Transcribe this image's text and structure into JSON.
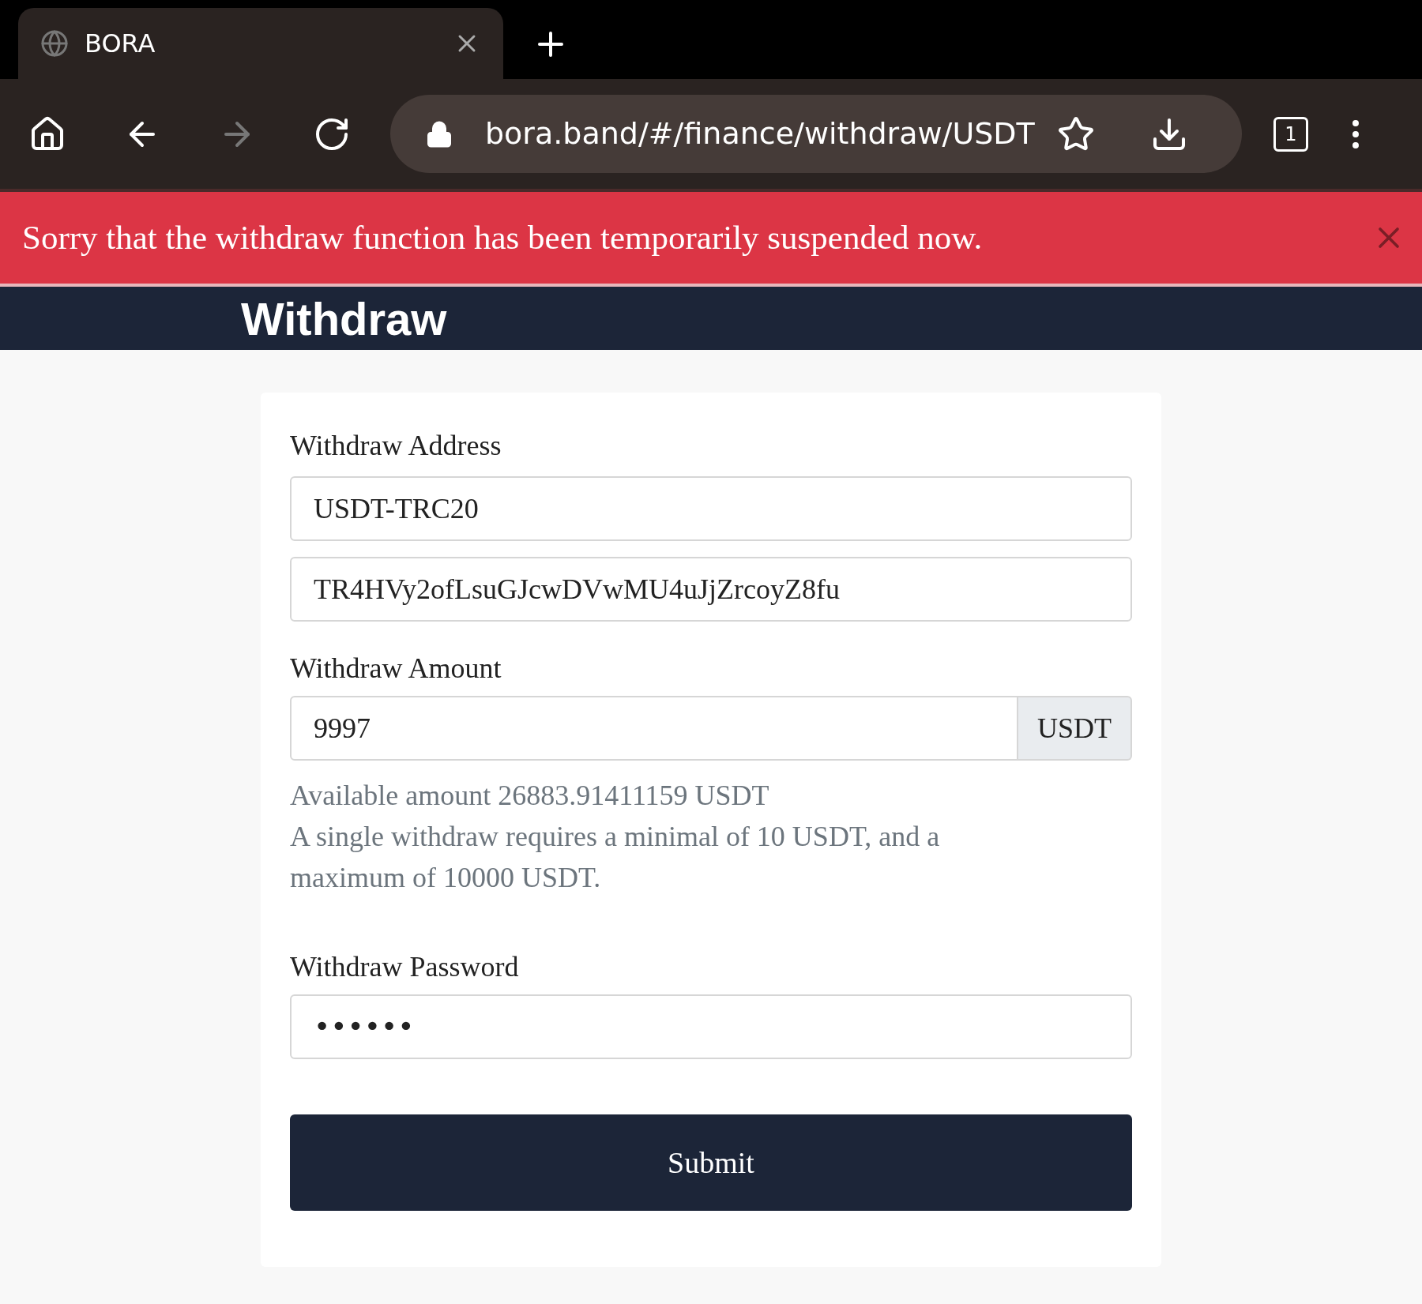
{
  "browser": {
    "tab": {
      "title": "BORA"
    },
    "url": "bora.band/#/finance/withdraw/USDT",
    "tab_count": "1"
  },
  "banner": {
    "message": "Sorry that the withdraw function has been temporarily suspended now."
  },
  "header": {
    "title": "Withdraw"
  },
  "form": {
    "address_label": "Withdraw Address",
    "network": "USDT-TRC20",
    "address": "TR4HVy2ofLsuGJcwDVwMU4uJjZrcoyZ8fu",
    "amount_label": "Withdraw Amount",
    "amount": "9997",
    "amount_unit": "USDT",
    "available": "Available amount 26883.91411159 USDT",
    "limits": "A single withdraw requires a minimal of 10 USDT, and a maximum of 10000 USDT.",
    "password_label": "Withdraw Password",
    "password": "••••••",
    "submit": "Submit"
  }
}
